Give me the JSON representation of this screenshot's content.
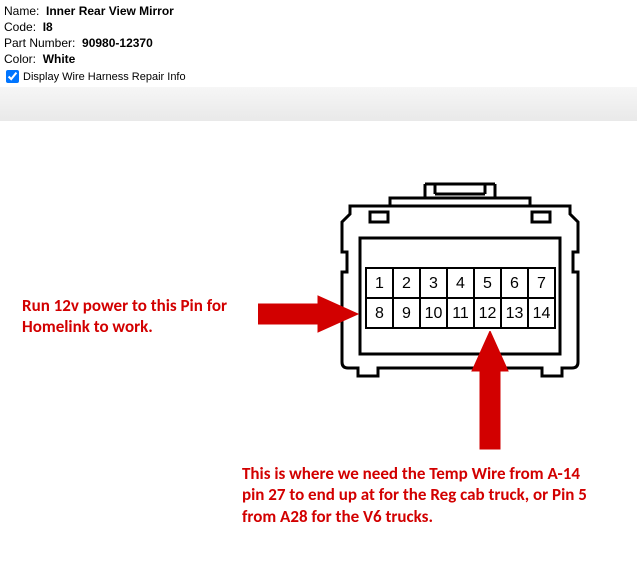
{
  "header": {
    "name_label": "Name:",
    "name_value": "Inner Rear View Mirror",
    "code_label": "Code:",
    "code_value": "I8",
    "part_label": "Part Number:",
    "part_value": "90980-12370",
    "color_label": "Color:",
    "color_value": "White",
    "checkbox_label": "Display Wire Harness Repair Info",
    "checkbox_checked": true
  },
  "connector": {
    "pins_row1": [
      "1",
      "2",
      "3",
      "4",
      "5",
      "6",
      "7"
    ],
    "pins_row2": [
      "8",
      "9",
      "10",
      "11",
      "12",
      "13",
      "14"
    ]
  },
  "annotations": {
    "note1": "Run 12v power to this Pin for Homelink to work.",
    "note2": "This is where we need the Temp Wire from A-14 pin 27 to end up at for the Reg cab truck, or Pin 5 from A28 for the V6 trucks."
  }
}
